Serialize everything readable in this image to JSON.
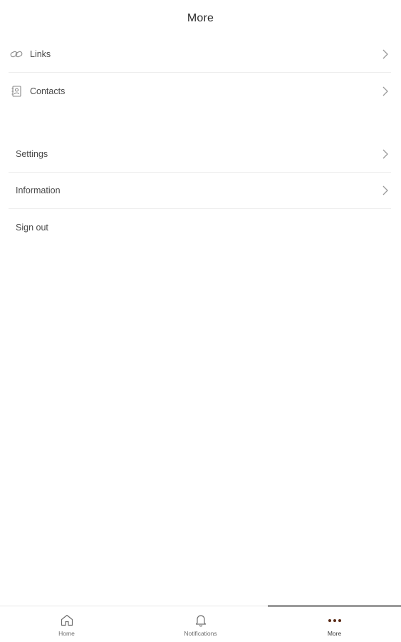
{
  "header": {
    "title": "More"
  },
  "sections": {
    "primary": [
      {
        "label": "Links",
        "icon": "link-icon"
      },
      {
        "label": "Contacts",
        "icon": "contacts-icon"
      }
    ],
    "secondary": [
      {
        "label": "Settings"
      },
      {
        "label": "Information"
      },
      {
        "label": "Sign out"
      }
    ]
  },
  "tabbar": {
    "tabs": [
      {
        "label": "Home",
        "icon": "home-icon"
      },
      {
        "label": "Notifications",
        "icon": "bell-icon"
      },
      {
        "label": "More",
        "icon": "more-dots-icon",
        "active": true
      }
    ]
  },
  "colors": {
    "accent": "#5a2a16",
    "text": "#3a3a3a",
    "divider": "#ededed"
  }
}
